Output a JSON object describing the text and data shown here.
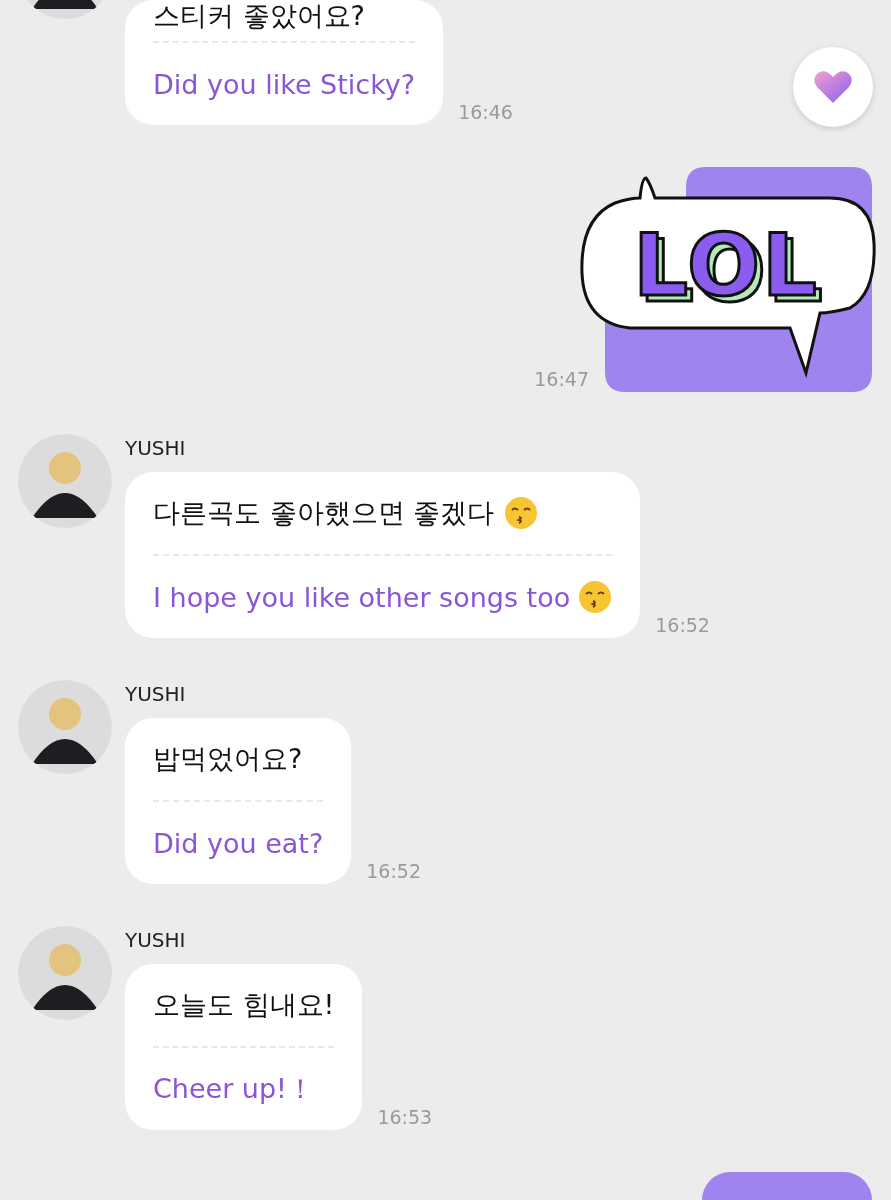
{
  "messages": [
    {
      "kind": "received",
      "cut": true,
      "korean": "스티커 좋았어요?",
      "english": "Did you like Sticky?",
      "time": "16:46"
    },
    {
      "kind": "sent_sticker",
      "sticker_text": "LOL",
      "time": "16:47"
    },
    {
      "kind": "received",
      "name": "YUSHI",
      "korean": "다른곡도 좋아했으면 좋겠다",
      "english": "I hope you like other songs too",
      "emoji": true,
      "time": "16:52"
    },
    {
      "kind": "received",
      "name": "YUSHI",
      "korean": "밥먹었어요?",
      "english": "Did you eat?",
      "time": "16:52"
    },
    {
      "kind": "received",
      "name": "YUSHI",
      "korean": "오늘도 힘내요!",
      "english": "Cheer up!！",
      "time": "16:53"
    },
    {
      "kind": "sent_partial"
    }
  ],
  "floating_button": {
    "kind": "heart"
  }
}
